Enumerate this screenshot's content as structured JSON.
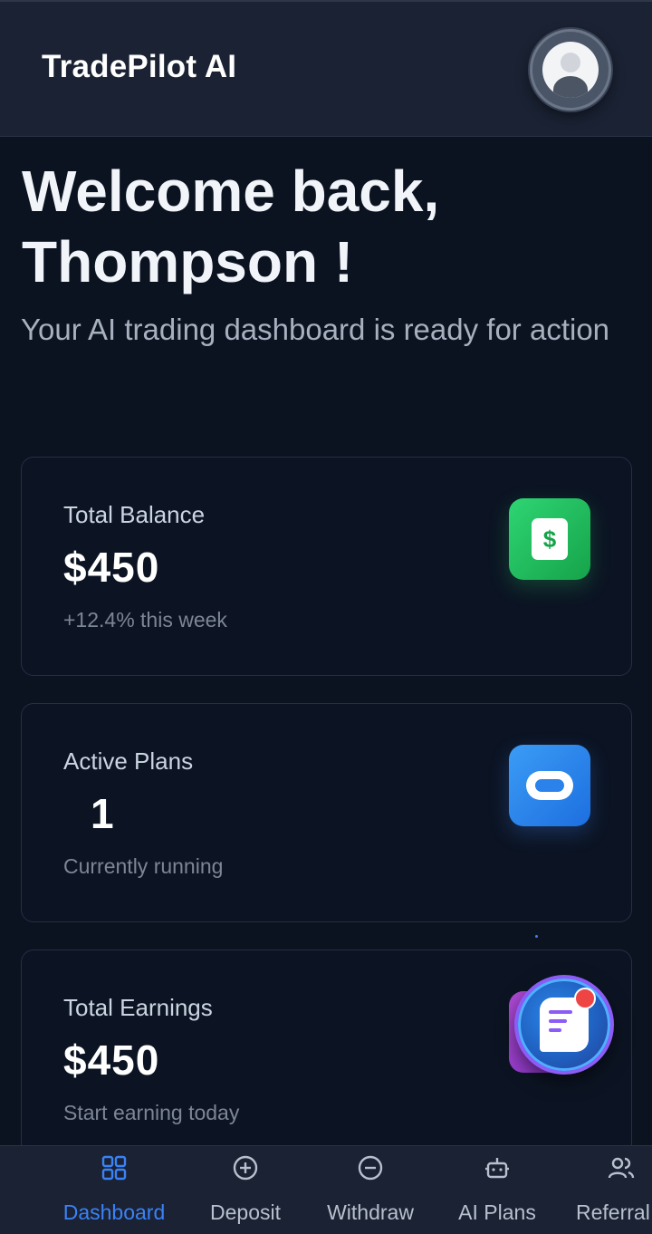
{
  "header": {
    "brand": "TradePilot AI",
    "avatar_icon": "user-avatar-icon"
  },
  "welcome": {
    "line1": "Welcome back,",
    "line2": "Thompson !",
    "subtitle": "Your AI trading dashboard is ready for action"
  },
  "cards": [
    {
      "label": "Total Balance",
      "value": "$450",
      "note": "+12.4% this week",
      "icon": "dollar-icon",
      "icon_symbol": "$",
      "accent": "#22c55e"
    },
    {
      "label": "Active Plans",
      "value": "1",
      "note": "Currently running",
      "icon": "plan-pill-icon",
      "accent": "#2b82ea"
    },
    {
      "label": "Total Earnings",
      "value": "$450",
      "note": "Start earning today",
      "icon": "earnings-icon",
      "accent": "#a855f7"
    }
  ],
  "chat": {
    "icon": "chat-support-icon",
    "badge_color": "#ef4444"
  },
  "nav": {
    "active_color": "#3b82f6",
    "items": [
      {
        "label": "Dashboard",
        "icon": "dashboard-grid-icon"
      },
      {
        "label": "Deposit",
        "icon": "plus-circle-icon"
      },
      {
        "label": "Withdraw",
        "icon": "minus-circle-icon"
      },
      {
        "label": "AI Plans",
        "icon": "robot-icon"
      },
      {
        "label": "Referral",
        "icon": "users-icon"
      }
    ]
  }
}
